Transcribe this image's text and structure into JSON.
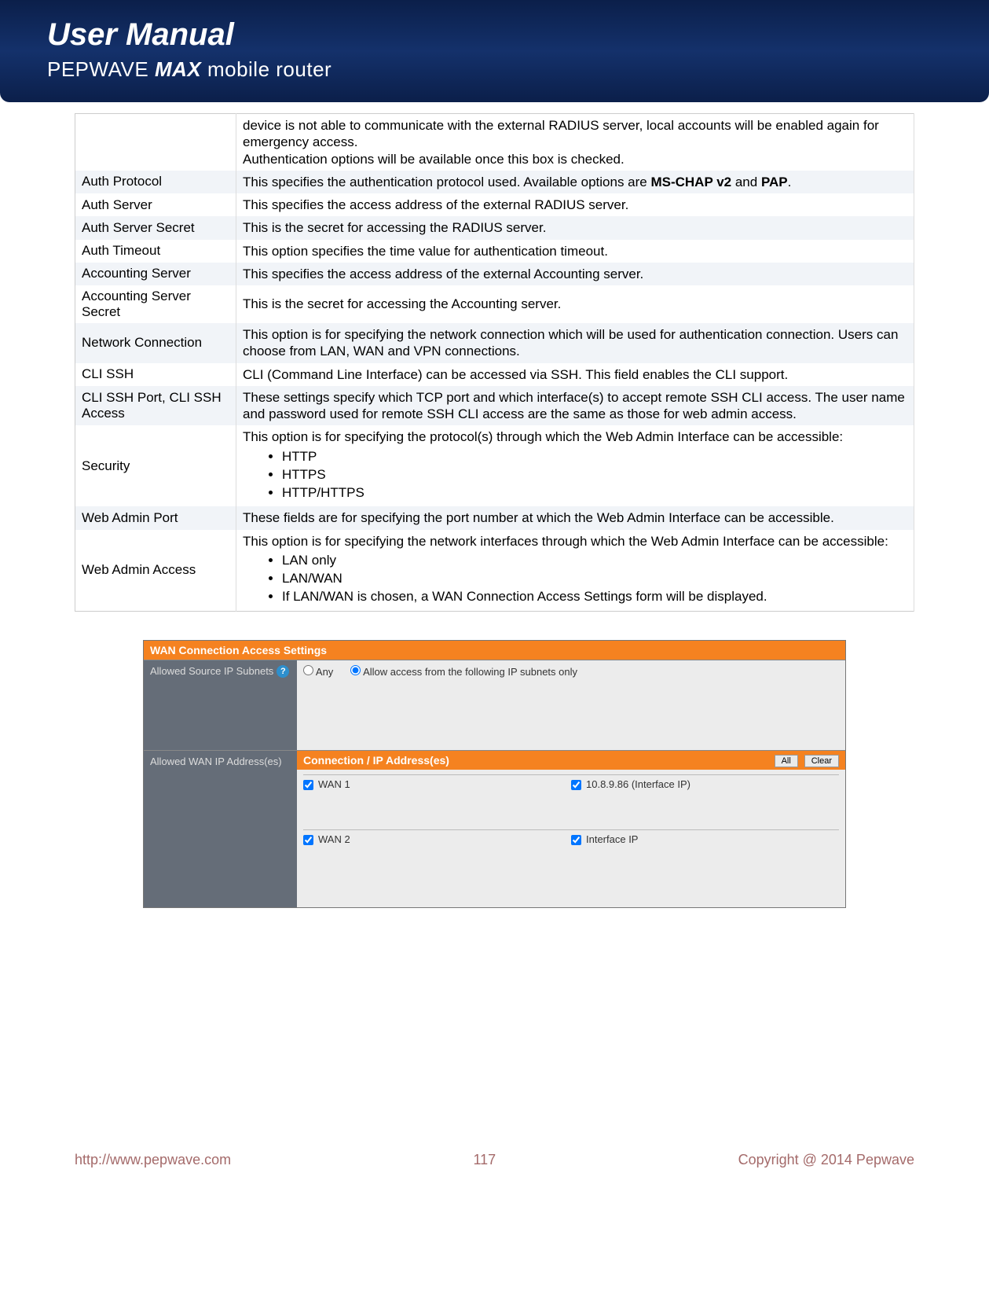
{
  "header": {
    "title": "User Manual",
    "brand1": "PEPWAVE",
    "brand2": "MAX",
    "tail": "mobile router"
  },
  "table": {
    "rows": [
      {
        "label": "",
        "desc_html": "device is not able to communicate with the external RADIUS server, local accounts will be enabled again for emergency access.\nAuthentication options will be available once this box is checked."
      },
      {
        "label": "Auth Protocol",
        "desc_html": "This specifies the authentication protocol used. Available options are <b>MS-CHAP v2</b> and <b>PAP</b>."
      },
      {
        "label": "Auth Server",
        "desc_html": "This specifies the access address of the external RADIUS server."
      },
      {
        "label": "Auth Server Secret",
        "desc_html": "This is the secret for accessing the RADIUS server."
      },
      {
        "label": "Auth Timeout",
        "desc_html": "This option specifies the time value for authentication timeout."
      },
      {
        "label": "Accounting Server",
        "desc_html": "This specifies the access address of the external Accounting server."
      },
      {
        "label": "Accounting Server Secret",
        "desc_html": "This is the secret for accessing the Accounting server."
      },
      {
        "label": "Network Connection",
        "desc_html": "This option is for specifying the network connection which will be used for authentication connection. Users can choose from LAN, WAN and VPN connections."
      },
      {
        "label": "CLI SSH",
        "desc_html": "CLI (Command Line Interface) can be accessed via SSH. This field enables the CLI support."
      },
      {
        "label": "CLI SSH Port, CLI SSH Access",
        "desc_html": "These settings specify which TCP port and which interface(s) to accept remote SSH CLI access. The user name and password used for remote SSH CLI access are the same as those for web admin access."
      },
      {
        "label": "Security",
        "desc_html": "This option is for specifying the protocol(s) through which the Web Admin Interface can be accessible:",
        "bullets": [
          "HTTP",
          "HTTPS",
          "HTTP/HTTPS"
        ]
      },
      {
        "label": "Web Admin Port",
        "desc_html": "These fields are for specifying the port number at which the Web Admin Interface can be accessible."
      },
      {
        "label": "Web Admin Access",
        "desc_html": "This option is for specifying the network interfaces through which the Web Admin Interface can be accessible:",
        "bullets": [
          "LAN only",
          "LAN/WAN",
          "If LAN/WAN is chosen, a WAN Connection Access Settings form will be displayed."
        ]
      }
    ]
  },
  "settings": {
    "panel_title": "WAN Connection Access Settings",
    "row1_label": "Allowed Source IP Subnets",
    "row2_label": "Allowed WAN IP Address(es)",
    "radio_any": "Any",
    "radio_allow": "Allow access from the following IP subnets only",
    "conn_head": "Connection / IP Address(es)",
    "btn_all": "All",
    "btn_clear": "Clear",
    "wan1": "WAN 1",
    "wan1_ip": "10.8.9.86 (Interface IP)",
    "wan2": "WAN 2",
    "wan2_ip": "Interface IP"
  },
  "footer": {
    "url": "http://www.pepwave.com",
    "page": "117",
    "copyright": "Copyright @ 2014 Pepwave"
  }
}
